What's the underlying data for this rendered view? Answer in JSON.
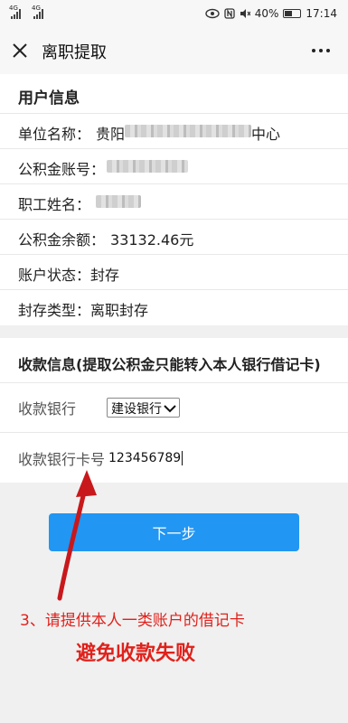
{
  "status_bar": {
    "signal1": "4G",
    "signal2": "4G",
    "battery": "40%",
    "time": "17:14",
    "icons": [
      "eye-icon",
      "nfc-icon",
      "mute-icon",
      "battery-icon"
    ]
  },
  "header": {
    "title": "离职提取",
    "close_icon": "close-icon",
    "more_icon": "more-icon"
  },
  "user_info": {
    "heading": "用户信息",
    "employer_label": "单位名称：",
    "employer_prefix": "贵阳",
    "employer_suffix": "中心",
    "account_label": "公积金账号：",
    "name_label": "职工姓名：",
    "balance_label": "公积金余额：",
    "balance_value": "33132.46元",
    "status_label": "账户状态：",
    "status_value": "封存",
    "seal_label": "封存类型：",
    "seal_value": "离职封存"
  },
  "payment_info": {
    "heading": "收款信息(提取公积金只能转入本人银行借记卡)",
    "bank_label": "收款银行",
    "bank_selected": "建设银行",
    "card_label": "收款银行卡号",
    "card_value": "123456789"
  },
  "actions": {
    "next_label": "下一步"
  },
  "annotation": {
    "line1": "3、请提供本人一类账户的借记卡",
    "line2": "避免收款失败",
    "color": "#e0211b"
  },
  "colors": {
    "primary_button": "#2196f3",
    "background": "#f0f0f0"
  }
}
